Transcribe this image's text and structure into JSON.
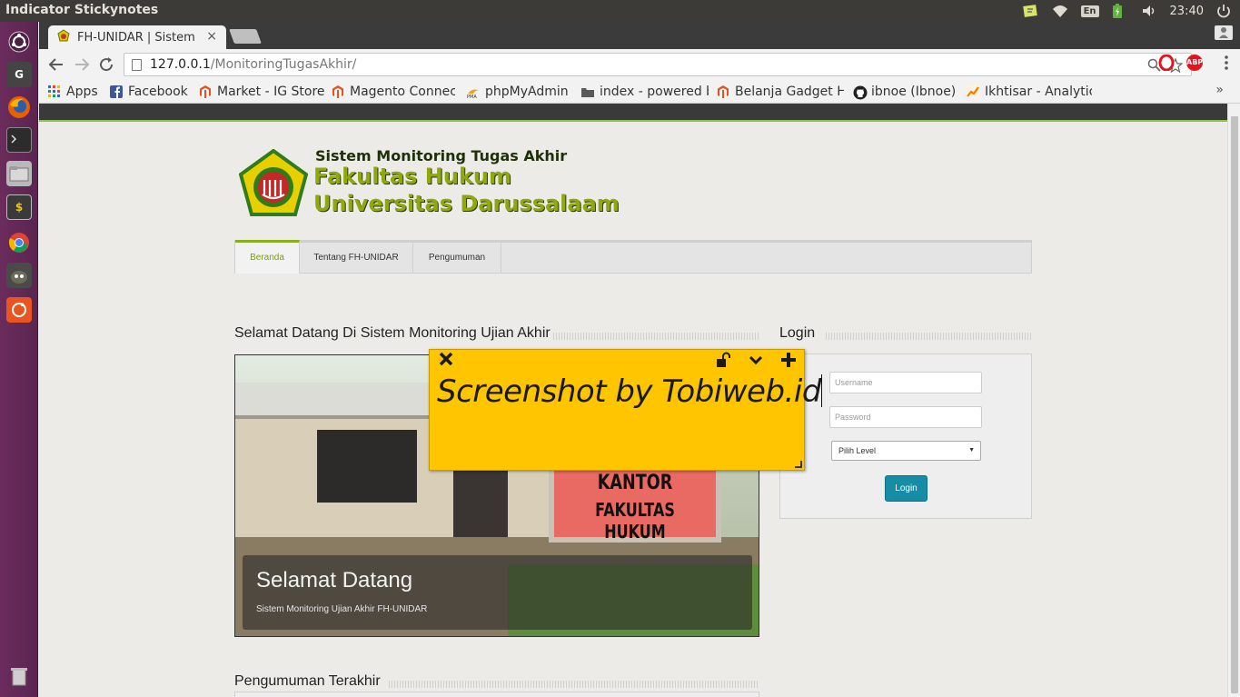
{
  "os": {
    "app_title": "Indicator Stickynotes",
    "keyboard_layout": "En",
    "clock": "23:40"
  },
  "launcher": {
    "items": [
      "ubuntu-dash-icon",
      "gnome-icon",
      "firefox-icon",
      "terminal-icon",
      "files-icon",
      "budget-icon",
      "chrome-icon",
      "gimp-icon",
      "software-updater-icon",
      "trash-icon"
    ]
  },
  "browser": {
    "tab_title": "FH-UNIDAR | Sistem",
    "tab_close": "×",
    "address_host": "127.0.0.1",
    "address_path": "/MonitoringTugasAkhir/",
    "bookmarks": [
      {
        "label": "Apps",
        "icon": "apps-grid-icon",
        "color": "#3366cc"
      },
      {
        "label": "Facebook",
        "icon": "facebook-icon",
        "color": "#3b5998"
      },
      {
        "label": "Market - IG Store",
        "icon": "magento-icon",
        "color": "#e2531f"
      },
      {
        "label": "Magento Connec",
        "icon": "magento-icon",
        "color": "#e2531f"
      },
      {
        "label": "phpMyAdmin",
        "icon": "phpmyadmin-icon",
        "color": "#f0a30a"
      },
      {
        "label": "index - powered b",
        "icon": "folder-icon",
        "color": "#5a5a5a"
      },
      {
        "label": "Belanja Gadget H",
        "icon": "magento-icon",
        "color": "#e2531f"
      },
      {
        "label": "ibnoe (Ibnoe)",
        "icon": "github-icon",
        "color": "#222222"
      },
      {
        "label": "Ikhtisar - Analytic",
        "icon": "analytics-icon",
        "color": "#f57c00"
      }
    ],
    "more": "»"
  },
  "site": {
    "logo": {
      "line1": "Sistem Monitoring Tugas Akhir",
      "line2": "Fakultas Hukum",
      "line3": "Universitas Darussalaam"
    },
    "nav": [
      "Beranda",
      "Tentang FH-UNIDAR",
      "Pengumuman"
    ],
    "welcome_title": "Selamat Datang Di Sistem Monitoring Ujian Akhir",
    "login_title": "Login",
    "hero": {
      "sign_line1": "KANTOR",
      "sign_line2": "FAKULTAS HUKUM",
      "caption_title": "Selamat Datang",
      "caption_sub": "Sistem Monitoring Ujian Akhir FH-UNIDAR"
    },
    "login": {
      "username_placeholder": "Username",
      "password_placeholder": "Password",
      "level_selected": "Pilih Level",
      "button": "Login"
    },
    "announcements_title": "Pengumuman Terakhir"
  },
  "sticky_note": {
    "text": "Screenshot by Tobiweb.id",
    "color": "#ffc600"
  },
  "colors": {
    "accent_green": "#8bad1a",
    "login_button": "#168ca6",
    "launcher": "#5e2750"
  }
}
